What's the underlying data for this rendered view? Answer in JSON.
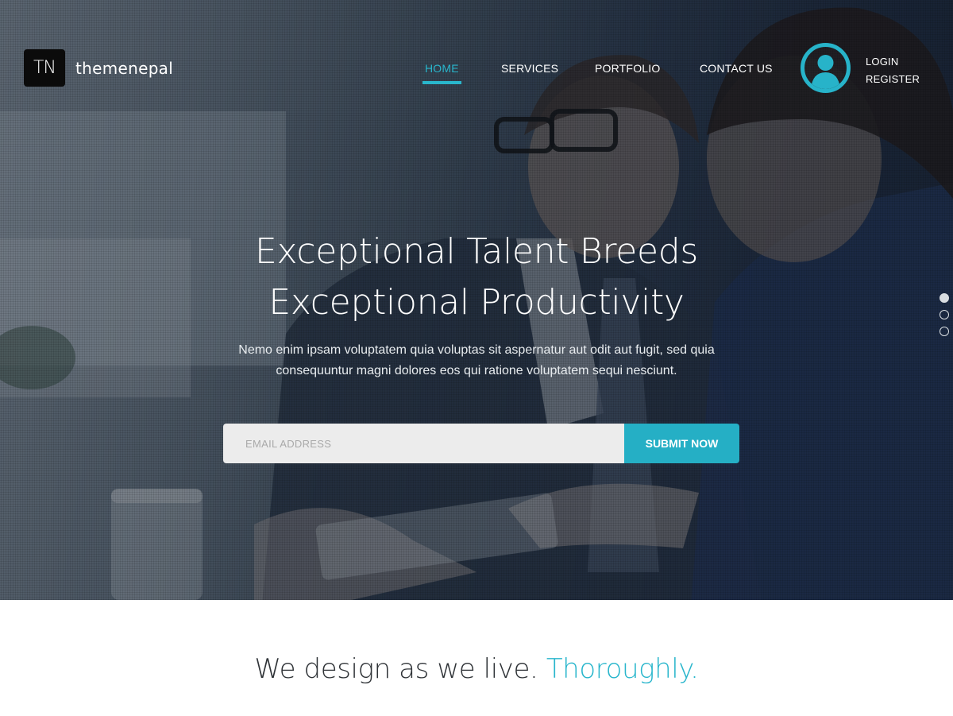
{
  "brand": {
    "logo_mark": "TN",
    "name": "themenepal"
  },
  "nav": {
    "items": [
      {
        "label": "HOME",
        "active": true
      },
      {
        "label": "SERVICES",
        "active": false
      },
      {
        "label": "PORTFOLIO",
        "active": false
      },
      {
        "label": "CONTACT US",
        "active": false
      }
    ]
  },
  "user": {
    "avatar_icon": "user-avatar-icon",
    "login_label": "LOGIN",
    "register_label": "REGISTER"
  },
  "hero": {
    "headline_line1": "Exceptional Talent Breeds",
    "headline_line2": "Exceptional Productivity",
    "subtext": "Nemo enim ipsam voluptatem quia voluptas sit aspernatur aut odit aut fugit, sed quia consequuntur magni dolores eos qui ratione voluptatem sequi nesciunt.",
    "email_placeholder": "EMAIL ADDRESS",
    "email_value": "",
    "submit_label": "SUBMIT NOW",
    "slides_total": 3,
    "active_slide": 1
  },
  "tagline": {
    "main": "We design as we live.",
    "accent": "Thoroughly."
  },
  "colors": {
    "accent": "#29b6cc",
    "button": "#25afc5",
    "logo_bg": "#0b0b0b",
    "tagline_text": "#2f3337"
  }
}
